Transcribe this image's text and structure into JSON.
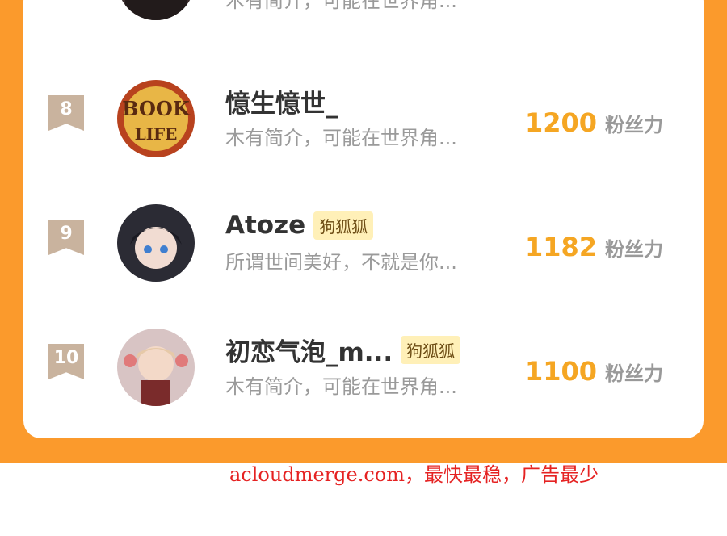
{
  "colors": {
    "page_bg": "#fb9a2c",
    "card_bg": "#ffffff",
    "rank_badge": "#c9b39e",
    "fans_number": "#f5a623",
    "badge_bg": "#fff0b8",
    "watermark": "#e52222"
  },
  "ranking": {
    "rows": [
      {
        "rank": "",
        "name": "",
        "badge": "",
        "bio": "木有简介，可能在世界角...",
        "fans_value": "",
        "fans_label": "",
        "avatar_icon": "dark-haired-avatar-icon"
      },
      {
        "rank": "8",
        "name": "憶生憶世_",
        "badge": "",
        "bio": "木有简介，可能在世界角...",
        "fans_value": "1200",
        "fans_label": "粉丝力",
        "avatar_icon": "book-of-life-avatar-icon"
      },
      {
        "rank": "9",
        "name": "Atoze",
        "badge": "狗狐狐",
        "bio": "所谓世间美好，不就是你...",
        "fans_value": "1182",
        "fans_label": "粉丝力",
        "avatar_icon": "anime-girl-avatar-icon"
      },
      {
        "rank": "10",
        "name": "初恋气泡_m...",
        "badge": "狗狐狐",
        "bio": "木有简介，可能在世界角...",
        "fans_value": "1100",
        "fans_label": "粉丝力",
        "avatar_icon": "anime-character-pink-avatar-icon"
      }
    ]
  },
  "watermark": {
    "text": "acloudmerge.com，最快最稳，广告最少"
  }
}
